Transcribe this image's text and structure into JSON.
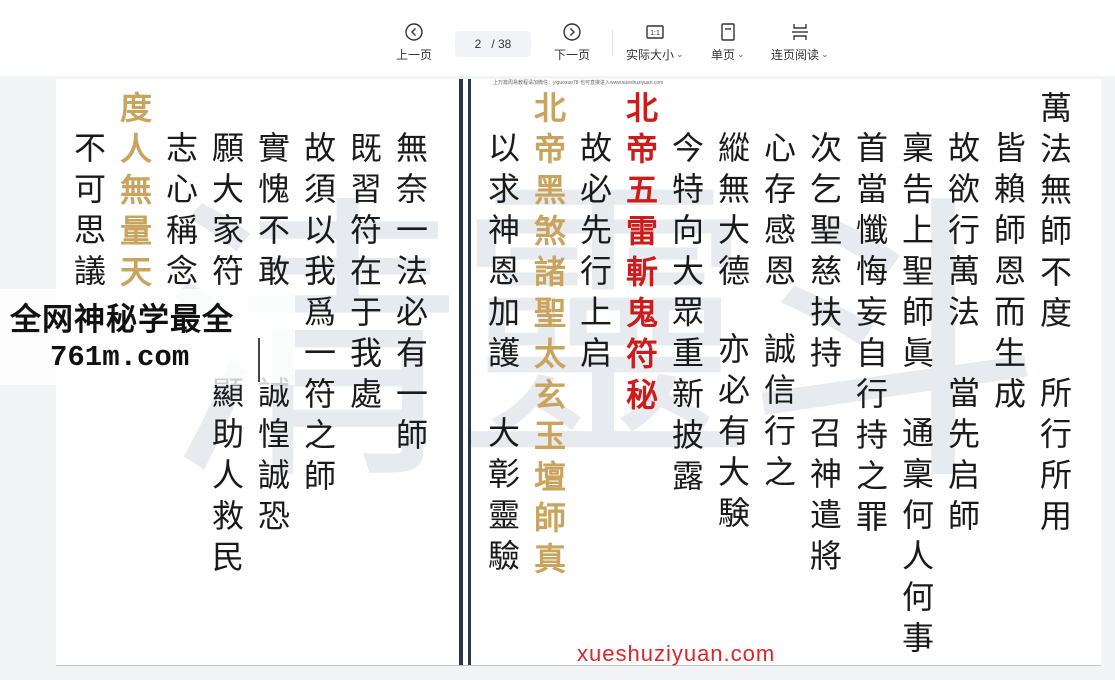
{
  "toolbar": {
    "prev_label": "上一页",
    "next_label": "下一页",
    "current_page": "2",
    "total_pages": "/ 38",
    "actual_size_label": "实际大小",
    "actual_size_icon_text": "1:1",
    "single_page_label": "单页",
    "continuous_label": "连页阅读"
  },
  "document": {
    "top_note": "上万篇周易教程请加微信：yiguoxue78   也可直接进入www.xueshuziyuan.com",
    "watermark_chars": [
      "清",
      "靈",
      "斗"
    ],
    "columns": [
      {
        "text": "萬法無師不度",
        "style": "normal"
      },
      {
        "text": "皆賴師恩而生成",
        "style": "normal"
      },
      {
        "text": "故欲行萬法",
        "style": "normal"
      },
      {
        "text": "稟告上聖師眞",
        "style": "normal"
      },
      {
        "text": "首當懺悔妄自行持之罪",
        "style": "normal"
      },
      {
        "text": "次乞聖慈扶持",
        "style": "normal"
      },
      {
        "text": "心存感恩",
        "style": "normal"
      },
      {
        "text": "縱無大德",
        "style": "normal"
      },
      {
        "text": "今特向大眾重新披露",
        "style": "normal"
      },
      {
        "text": "北帝五雷斬鬼符秘",
        "style": "red"
      },
      {
        "text": "故必先行上启",
        "style": "normal"
      },
      {
        "text": "北帝黑煞諸聖太玄玉壇師真",
        "style": "gold"
      },
      {
        "text": "以求神恩加護",
        "style": "normal"
      },
      {
        "text": "無奈一法必有一師",
        "style": "normal"
      },
      {
        "text": "既習符在于我處",
        "style": "normal"
      },
      {
        "text": "故須以我爲一符之師",
        "style": "normal"
      },
      {
        "text": "實愧不敢",
        "style": "normal"
      },
      {
        "text": "願大家符",
        "style": "normal"
      },
      {
        "text": "志心稱念",
        "style": "normal"
      },
      {
        "text": "度人無量天",
        "style": "gold"
      },
      {
        "text": "不可思議",
        "style": "normal"
      }
    ],
    "fragments": [
      {
        "text": "所行所用"
      },
      {
        "text": "當先启師"
      },
      {
        "text": "通稟何人何事"
      },
      {
        "text": "召神遣將"
      },
      {
        "text": "誠信行之"
      },
      {
        "text": "亦必有大験"
      },
      {
        "text": "大彰靈驗"
      },
      {
        "text": "誠惶誠恐"
      },
      {
        "text": "顯助人救民"
      }
    ]
  },
  "overlays": {
    "banner_title": "全网神秘学最全",
    "banner_url": "761m.com",
    "bottom_watermark": "xueshuziyuan.com"
  },
  "colors": {
    "red_title": "#cc1d1d",
    "gold_title": "#c9a45e",
    "watermark_red": "#d9262b"
  }
}
